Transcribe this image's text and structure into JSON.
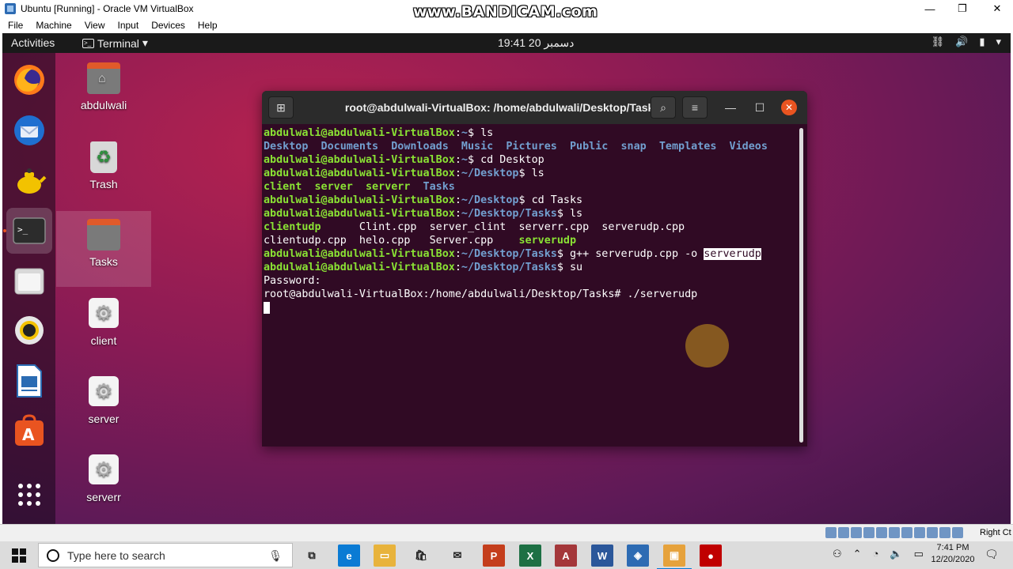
{
  "vbox": {
    "title": "Ubuntu [Running] - Oracle VM VirtualBox",
    "menu": [
      "File",
      "Machine",
      "View",
      "Input",
      "Devices",
      "Help"
    ],
    "watermark": "www.BANDICAM.com",
    "minimize": "—",
    "maximize": "❐",
    "close": "✕",
    "status_host_key": "Right Ct"
  },
  "ubuntu_bar": {
    "activities": "Activities",
    "app_menu": "Terminal",
    "clock": "19:41  20 دسمبر",
    "tray_icons": [
      "network-icon",
      "volume-icon",
      "battery-icon",
      "power-menu-icon"
    ]
  },
  "dock": {
    "items": [
      "firefox-icon",
      "thunderbird-icon",
      "teapot-icon",
      "terminal-icon",
      "files-icon",
      "rhythmbox-icon",
      "libreoffice-writer-icon",
      "software-icon",
      "app-grid-icon"
    ]
  },
  "desktop": {
    "icons": [
      {
        "label": "abdulwali",
        "type": "home-folder"
      },
      {
        "label": "Trash",
        "type": "trash"
      },
      {
        "label": "Tasks",
        "type": "folder"
      },
      {
        "label": "client",
        "type": "executable"
      },
      {
        "label": "server",
        "type": "executable"
      },
      {
        "label": "serverr",
        "type": "executable"
      }
    ]
  },
  "terminal": {
    "title": "root@abdulwali-VirtualBox: /home/abdulwali/Desktop/Tasks",
    "lines": [
      {
        "prompt": "abdulwali@abdulwali-VirtualBox",
        "path": "~",
        "cmd": " ls"
      },
      {
        "dirs": "Desktop  Documents  Downloads  Music  Pictures  Public  snap  Templates  Videos"
      },
      {
        "prompt": "abdulwali@abdulwali-VirtualBox",
        "path": "~",
        "cmd": " cd Desktop"
      },
      {
        "prompt": "abdulwali@abdulwali-VirtualBox",
        "path": "~/Desktop",
        "cmd": " ls"
      },
      {
        "exes": "client  server  serverr  ",
        "dirs2": "Tasks"
      },
      {
        "prompt": "abdulwali@abdulwali-VirtualBox",
        "path": "~/Desktop",
        "cmd": " cd Tasks"
      },
      {
        "prompt": "abdulwali@abdulwali-VirtualBox",
        "path": "~/Desktop/Tasks",
        "cmd": " ls"
      },
      {
        "exe1": "clientudp",
        "plain1": "      Clint.cpp  server_clint  serverr.cpp  serverudp.cpp"
      },
      {
        "plain2": "clientudp.cpp  helo.cpp   Server.cpp    ",
        "exe2": "serverudp"
      },
      {
        "prompt": "abdulwali@abdulwali-VirtualBox",
        "path": "~/Desktop/Tasks",
        "cmd": " g++ serverudp.cpp -o ",
        "selected": "serverudp"
      },
      {
        "prompt": "abdulwali@abdulwali-VirtualBox",
        "path": "~/Desktop/Tasks",
        "cmd": " su"
      },
      {
        "plain": "Password:"
      },
      {
        "plain": "root@abdulwali-VirtualBox:/home/abdulwali/Desktop/Tasks# ./serverudp"
      }
    ]
  },
  "taskbar": {
    "search_placeholder": "Type here to search",
    "time": "7:41 PM",
    "date": "12/20/2020",
    "apps": [
      {
        "name": "task-view-icon",
        "glyph": "⧉",
        "color": "#dcdcdc"
      },
      {
        "name": "edge-icon",
        "glyph": "e",
        "color": "#0a7bd4"
      },
      {
        "name": "file-explorer-icon",
        "glyph": "▭",
        "color": "#e8b33c"
      },
      {
        "name": "store-icon",
        "glyph": "🛍",
        "color": "#dcdcdc"
      },
      {
        "name": "mail-icon",
        "glyph": "✉",
        "color": "#dcdcdc"
      },
      {
        "name": "powerpoint-icon",
        "glyph": "P",
        "color": "#c43e1c"
      },
      {
        "name": "excel-icon",
        "glyph": "X",
        "color": "#1d7044"
      },
      {
        "name": "access-icon",
        "glyph": "A",
        "color": "#a4373a"
      },
      {
        "name": "word-icon",
        "glyph": "W",
        "color": "#2b579a"
      },
      {
        "name": "virtualbox-icon",
        "glyph": "◈",
        "color": "#2d6bb3"
      },
      {
        "name": "ubuntu-vm-icon",
        "glyph": "▣",
        "color": "#e6a23c"
      },
      {
        "name": "bandicam-record-icon",
        "glyph": "●",
        "color": "#c00000"
      }
    ]
  }
}
